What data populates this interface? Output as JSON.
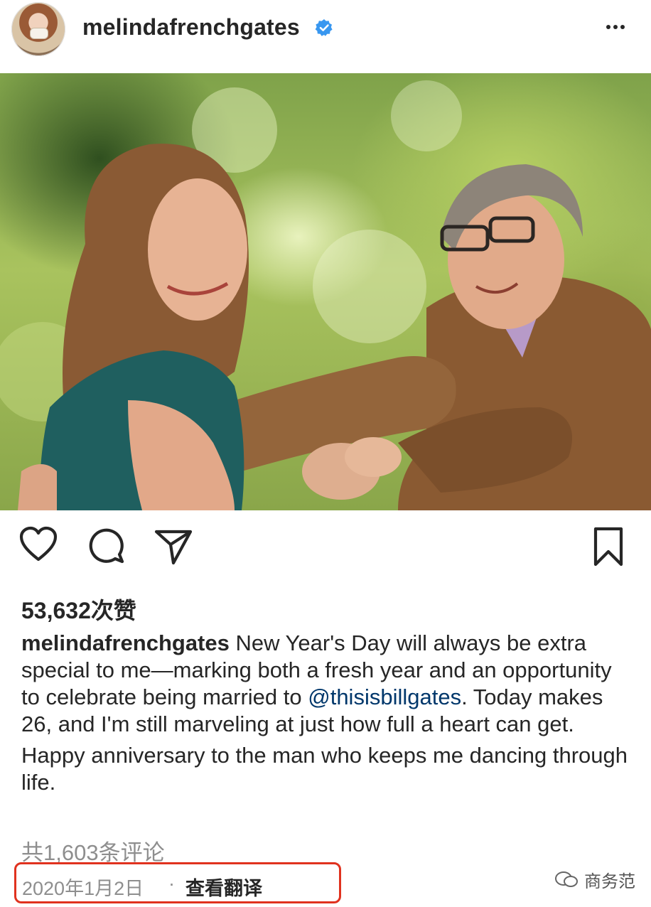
{
  "post": {
    "username": "melindafrenchgates",
    "verified": true,
    "more_icon": "more-horizontal-icon",
    "likes": "53,632次赞",
    "caption": {
      "username": "melindafrenchgates",
      "line1": " New Year's Day will always be extra special to me—marking both a fresh year and an opportunity to celebrate being married to ",
      "mention": "@thisisbillgates",
      "line1_end": ". Today makes 26, and I'm still marveling at just how full a heart can get.",
      "paragraph2": "Happy anniversary to the man who keeps me dancing through life."
    },
    "comments": "共1,603条评论",
    "date": "2020年1月2日",
    "separator": "·",
    "translate": "查看翻译"
  },
  "watermark": "商务范",
  "colors": {
    "verified_blue": "#3897f0",
    "highlight_border": "#e0321f",
    "mention": "#00376b"
  }
}
